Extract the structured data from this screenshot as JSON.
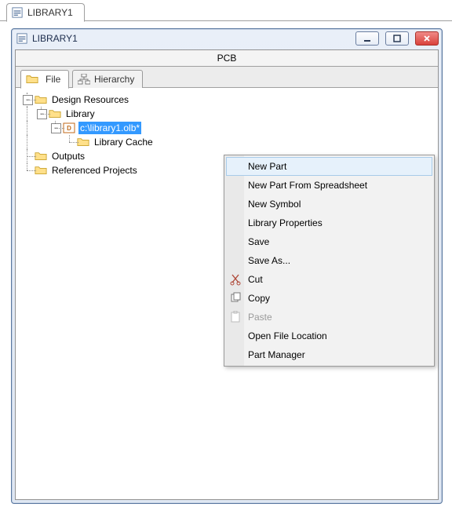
{
  "outer_tab": {
    "title": "LIBRARY1"
  },
  "child_window": {
    "title": "LIBRARY1"
  },
  "pcb_label": "PCB",
  "inner_tabs": {
    "file": "File",
    "hierarchy": "Hierarchy"
  },
  "tree": {
    "design_resources": "Design Resources",
    "library": "Library",
    "olb_file": "c:\\library1.olb*",
    "library_cache": "Library Cache",
    "outputs": "Outputs",
    "referenced_projects": "Referenced Projects"
  },
  "context_menu": {
    "new_part": "New Part",
    "new_part_from_spreadsheet": "New Part From Spreadsheet",
    "new_symbol": "New Symbol",
    "library_properties": "Library Properties",
    "save": "Save",
    "save_as": "Save As...",
    "cut": "Cut",
    "copy": "Copy",
    "paste": "Paste",
    "open_file_location": "Open File Location",
    "part_manager": "Part Manager"
  },
  "expander_minus": "−"
}
